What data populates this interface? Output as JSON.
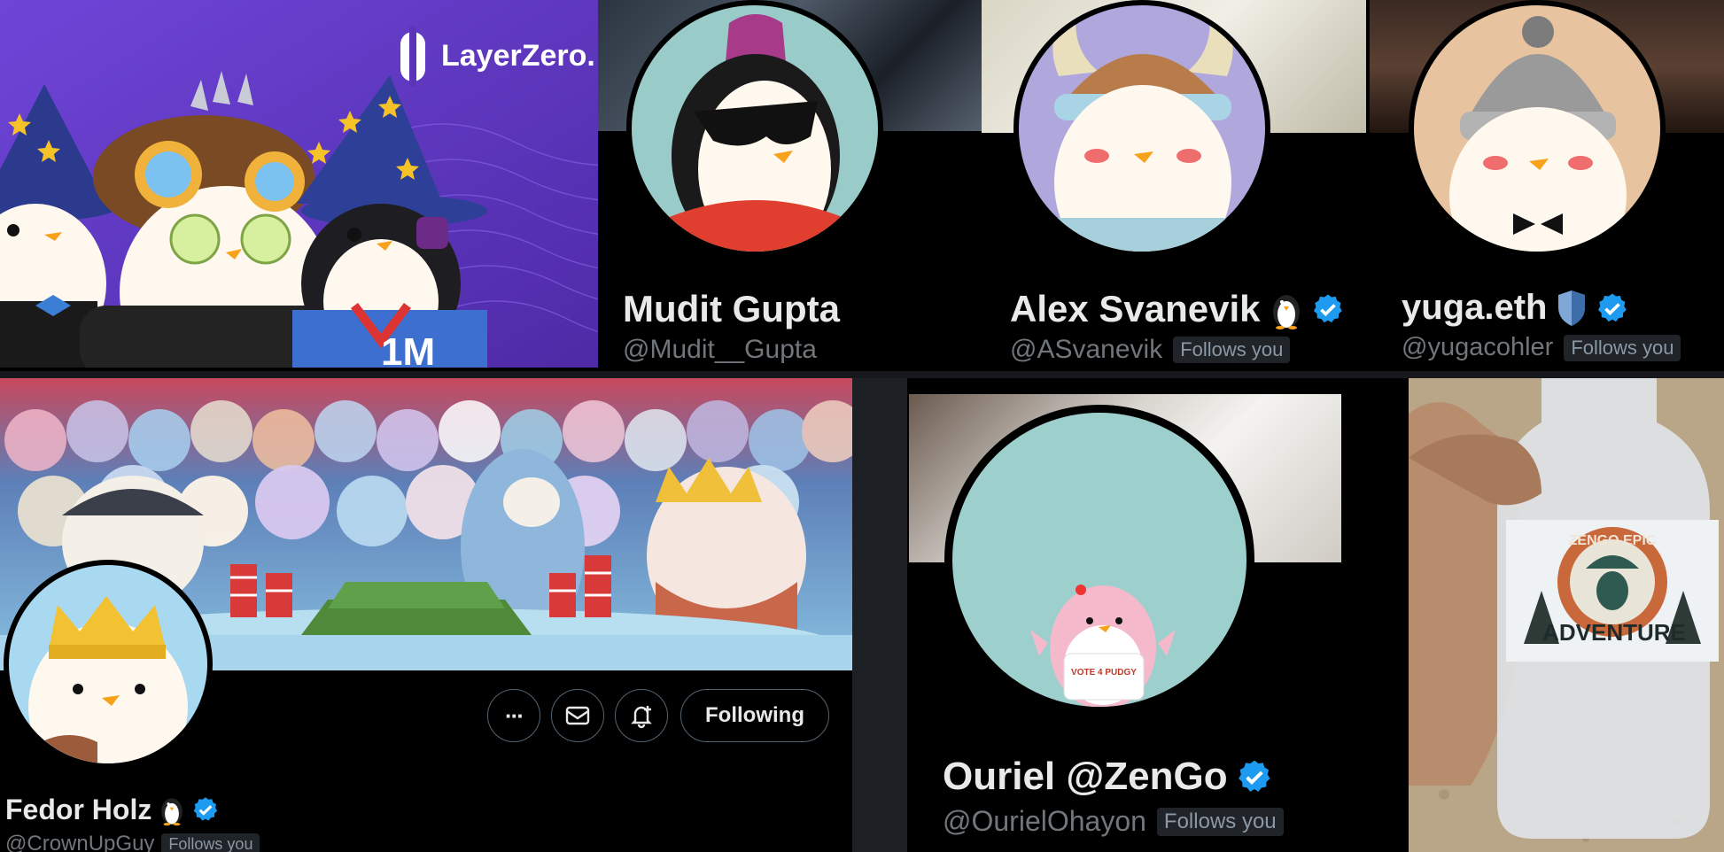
{
  "colors": {
    "verified": "#1d9bf0",
    "background": "#000000",
    "layerzero_purple": "#6a3fd0"
  },
  "banner_1": {
    "logo_text": "LayerZero.",
    "shirt_text": "1M"
  },
  "profiles": [
    {
      "name": "Mudit Gupta",
      "handle": "@Mudit__Gupta",
      "follows_you": "",
      "verified": false
    },
    {
      "name": "Alex Svanevik",
      "handle": "@ASvanevik",
      "follows_you": "Follows you",
      "verified": true,
      "emoji": "penguin-icon"
    },
    {
      "name": "yuga.eth",
      "handle": "@yugacohler",
      "follows_you": "Follows you",
      "verified": true,
      "emoji": "shield-icon"
    },
    {
      "name": "Fedor Holz",
      "handle": "@CrownUpGuy",
      "follows_you": "Follows you",
      "verified": true,
      "emoji": "penguin-icon"
    },
    {
      "name": "Ouriel @ZenGo",
      "handle": "@OurielOhayon",
      "follows_you": "Follows you",
      "verified": true
    }
  ],
  "actions": {
    "following_label": "Following",
    "more": "···"
  },
  "vote_shirt_text": "VOTE 4 PUDGY",
  "bottle": {
    "label_top": "ZENGO EPIC",
    "label_bottom": "ADVENTURE"
  }
}
